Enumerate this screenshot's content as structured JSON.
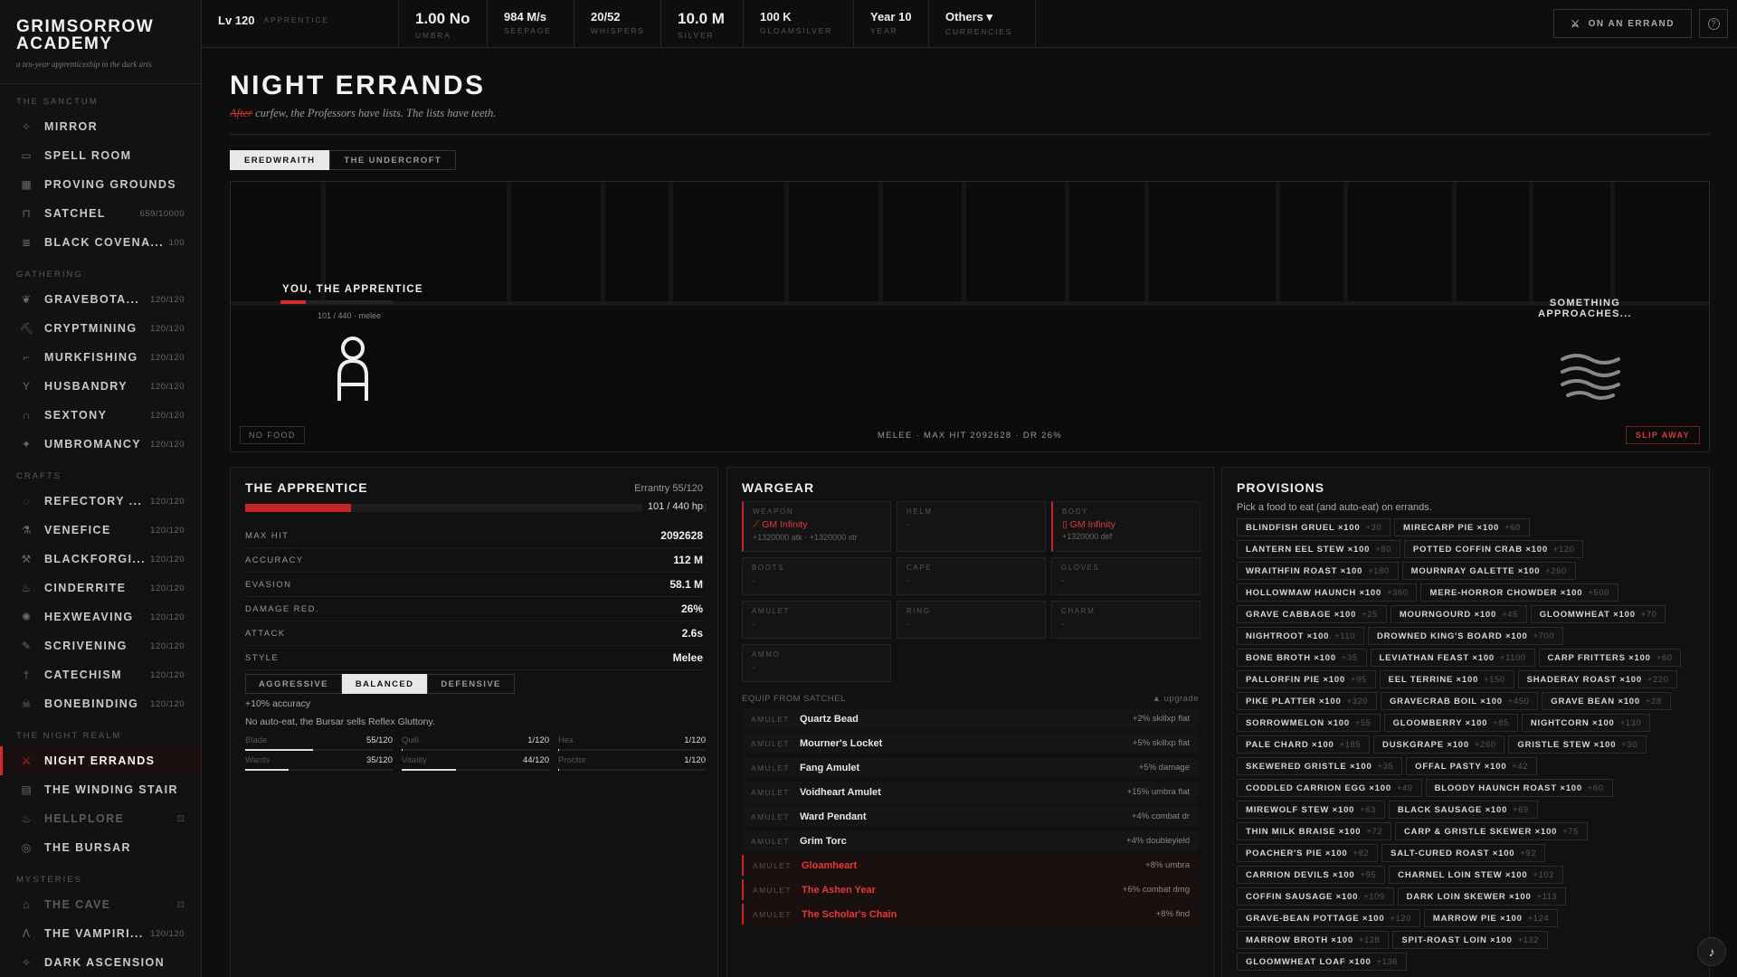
{
  "brand": {
    "title": "GRIMSORROW\nACADEMY",
    "subtitle": "a ten-year apprenticeship in the dark arts"
  },
  "sidebar": {
    "sections": [
      {
        "title": "THE SANCTUM",
        "items": [
          {
            "label": "MIRROR",
            "count": "",
            "icon": "sparkle-icon"
          },
          {
            "label": "SPELL ROOM",
            "count": "",
            "icon": "chat-icon"
          },
          {
            "label": "PROVING GROUNDS",
            "count": "",
            "icon": "grid-icon"
          },
          {
            "label": "SATCHEL",
            "count": "659/10000",
            "icon": "bag-icon"
          },
          {
            "label": "BLACK COVENA...",
            "count": "100",
            "icon": "scroll-icon"
          }
        ]
      },
      {
        "title": "GATHERING",
        "items": [
          {
            "label": "GRAVEBOTA...",
            "count": "120/120",
            "icon": "leaf-icon"
          },
          {
            "label": "CRYPTMINING",
            "count": "120/120",
            "icon": "pick-icon"
          },
          {
            "label": "MURKFISHING",
            "count": "120/120",
            "icon": "hook-icon"
          },
          {
            "label": "HUSBANDRY",
            "count": "120/120",
            "icon": "sprout-icon"
          },
          {
            "label": "SEXTONY",
            "count": "120/120",
            "icon": "tomb-icon"
          },
          {
            "label": "UMBROMANCY",
            "count": "120/120",
            "icon": "star-icon"
          }
        ]
      },
      {
        "title": "CRAFTS",
        "items": [
          {
            "label": "REFECTORY ...",
            "count": "120/120",
            "icon": "pot-icon"
          },
          {
            "label": "VENEFICE",
            "count": "120/120",
            "icon": "flask-icon"
          },
          {
            "label": "BLACKFORGI...",
            "count": "120/120",
            "icon": "hammer-icon"
          },
          {
            "label": "CINDERRITE",
            "count": "120/120",
            "icon": "flame-icon"
          },
          {
            "label": "HEXWEAVING",
            "count": "120/120",
            "icon": "web-icon"
          },
          {
            "label": "SCRIVENING",
            "count": "120/120",
            "icon": "quill-icon"
          },
          {
            "label": "CATECHISM",
            "count": "120/120",
            "icon": "candle-icon"
          },
          {
            "label": "BONEBINDING",
            "count": "120/120",
            "icon": "skull-icon"
          }
        ]
      },
      {
        "title": "THE NIGHT REALM",
        "items": [
          {
            "label": "NIGHT ERRANDS",
            "count": "",
            "icon": "crossed-swords-icon",
            "active": true
          },
          {
            "label": "THE WINDING STAIR",
            "count": "",
            "icon": "stairs-icon"
          },
          {
            "label": "HELLPLORE",
            "count": "",
            "icon": "flame-icon",
            "locked": true
          },
          {
            "label": "THE BURSAR",
            "count": "",
            "icon": "coin-icon"
          }
        ]
      },
      {
        "title": "MYSTERIES",
        "items": [
          {
            "label": "THE CAVE",
            "count": "",
            "icon": "cave-icon",
            "locked": true
          },
          {
            "label": "THE VAMPIRI...",
            "count": "120/120",
            "icon": "fang-icon"
          },
          {
            "label": "DARK ASCENSION",
            "count": "",
            "icon": "sparkle-icon"
          }
        ]
      }
    ]
  },
  "topbar": {
    "level": {
      "value": "Lv 120",
      "label": "APPRENTICE"
    },
    "stats": [
      {
        "value": "1.00 No",
        "label": "UMBRA",
        "big": true
      },
      {
        "value": "984 M/s",
        "label": "SEEPAGE"
      },
      {
        "value": "20/52",
        "label": "WHISPERS"
      },
      {
        "value": "10.0 M",
        "label": "SILVER",
        "big": true
      },
      {
        "value": "100 K",
        "label": "GLOAMSILVER"
      },
      {
        "value": "Year 10",
        "label": "YEAR"
      },
      {
        "value": "Others ▾",
        "label": "CURRENCIES"
      }
    ],
    "errand_button": "ON AN ERRAND",
    "help_icon": "?"
  },
  "page": {
    "title": "NIGHT ERRANDS",
    "sub_struck": "After",
    "sub_rest": " curfew, the Professors have lists. The lists have teeth."
  },
  "locations": [
    "EREDWRAITH",
    "THE UNDERCROFT"
  ],
  "arena": {
    "player_name": "YOU, THE APPRENTICE",
    "player_hp": "101 / 440 · melee",
    "player_hp_fraction": 0.2295,
    "foe_name": "SOMETHING APPROACHES...",
    "no_food": "NO FOOD",
    "combat_line": "MELEE · MAX HIT 2092628 · DR 26%",
    "slip": "SLIP AWAY"
  },
  "apprentice": {
    "title": "THE APPRENTICE",
    "errantry": "Errantry 55/120",
    "hp_text": "101 / 440 hp",
    "hp_fraction": 0.2295,
    "stats": [
      {
        "k": "MAX HIT",
        "v": "2092628"
      },
      {
        "k": "ACCURACY",
        "v": "112 M"
      },
      {
        "k": "EVASION",
        "v": "58.1 M"
      },
      {
        "k": "DAMAGE RED.",
        "v": "26%"
      },
      {
        "k": "ATTACK",
        "v": "2.6s"
      },
      {
        "k": "STYLE",
        "v": "Melee"
      }
    ],
    "styles": [
      "AGGRESSIVE",
      "BALANCED",
      "DEFENSIVE"
    ],
    "active_style": 1,
    "accuracy_note": "+10% accuracy",
    "bursar_note": "No auto-eat, the Bursar sells Reflex Gluttony.",
    "skills": [
      {
        "name": "Blade",
        "level": "55/120",
        "fraction": 0.458
      },
      {
        "name": "Quill",
        "level": "1/120",
        "fraction": 0.008
      },
      {
        "name": "Hex",
        "level": "1/120",
        "fraction": 0.008
      },
      {
        "name": "Wards",
        "level": "35/120",
        "fraction": 0.292
      },
      {
        "name": "Vitality",
        "level": "44/120",
        "fraction": 0.367
      },
      {
        "name": "Proctor",
        "level": "1/120",
        "fraction": 0.008
      }
    ]
  },
  "wargear": {
    "title": "WARGEAR",
    "slots": [
      {
        "slot": "WEAPON",
        "item": "⟋ GM Infinity",
        "bonus": "+1320000 atk · +1320000 str",
        "filled": true
      },
      {
        "slot": "HELM",
        "item": "-",
        "bonus": ""
      },
      {
        "slot": "BODY",
        "item": "▯ GM Infinity",
        "bonus": "+1320000 def",
        "filled": true
      },
      {
        "slot": "BOOTS",
        "item": "-",
        "bonus": ""
      },
      {
        "slot": "CAPE",
        "item": "-",
        "bonus": ""
      },
      {
        "slot": "GLOVES",
        "item": "-",
        "bonus": ""
      },
      {
        "slot": "AMULET",
        "item": "-",
        "bonus": ""
      },
      {
        "slot": "RING",
        "item": "-",
        "bonus": ""
      },
      {
        "slot": "CHARM",
        "item": "-",
        "bonus": ""
      },
      {
        "slot": "AMMO",
        "item": "-",
        "bonus": ""
      }
    ],
    "equip_header": "EQUIP FROM SATCHEL",
    "upgrade_label": "▲ upgrade",
    "equip_items": [
      {
        "type": "AMULET",
        "name": "Quartz Bead",
        "effect": "+2% skillxp flat"
      },
      {
        "type": "AMULET",
        "name": "Mourner's Locket",
        "effect": "+5% skillxp flat"
      },
      {
        "type": "AMULET",
        "name": "Fang Amulet",
        "effect": "+5% damage"
      },
      {
        "type": "AMULET",
        "name": "Voidheart Amulet",
        "effect": "+15% umbra flat"
      },
      {
        "type": "AMULET",
        "name": "Ward Pendant",
        "effect": "+4% combat dr"
      },
      {
        "type": "AMULET",
        "name": "Grim Torc",
        "effect": "+4% doubleyield"
      },
      {
        "type": "AMULET",
        "name": "Gloamheart",
        "effect": "+8% umbra",
        "red": true
      },
      {
        "type": "AMULET",
        "name": "The Ashen Year",
        "effect": "+6% combat dmg",
        "red": true
      },
      {
        "type": "AMULET",
        "name": "The Scholar's Chain",
        "effect": "+8% find",
        "red": true
      }
    ]
  },
  "provisions": {
    "title": "PROVISIONS",
    "note": "Pick a food to eat (and auto-eat) on errands.",
    "foods": [
      {
        "name": "BLINDFISH GRUEL ×100",
        "xp": "+30"
      },
      {
        "name": "MIRECARP PIE ×100",
        "xp": "+60"
      },
      {
        "name": "LANTERN EEL STEW ×100",
        "xp": "+80"
      },
      {
        "name": "POTTED COFFIN CRAB ×100",
        "xp": "+120"
      },
      {
        "name": "WRAITHFIN ROAST ×100",
        "xp": "+180"
      },
      {
        "name": "MOURNRAY GALETTE ×100",
        "xp": "+260"
      },
      {
        "name": "HOLLOWMAW HAUNCH ×100",
        "xp": "+360"
      },
      {
        "name": "MERE-HORROR CHOWDER ×100",
        "xp": "+500"
      },
      {
        "name": "GRAVE CABBAGE ×100",
        "xp": "+25"
      },
      {
        "name": "MOURNGOURD ×100",
        "xp": "+45"
      },
      {
        "name": "GLOOMWHEAT ×100",
        "xp": "+70"
      },
      {
        "name": "NIGHTROOT ×100",
        "xp": "+110"
      },
      {
        "name": "DROWNED KING'S BOARD ×100",
        "xp": "+700"
      },
      {
        "name": "BONE BROTH ×100",
        "xp": "+35"
      },
      {
        "name": "LEVIATHAN FEAST ×100",
        "xp": "+1100"
      },
      {
        "name": "CARP FRITTERS ×100",
        "xp": "+60"
      },
      {
        "name": "PALLORFIN PIE ×100",
        "xp": "+95"
      },
      {
        "name": "EEL TERRINE ×100",
        "xp": "+150"
      },
      {
        "name": "SHADERAY ROAST ×100",
        "xp": "+220"
      },
      {
        "name": "PIKE PLATTER ×100",
        "xp": "+320"
      },
      {
        "name": "GRAVECRAB BOIL ×100",
        "xp": "+450"
      },
      {
        "name": "GRAVE BEAN ×100",
        "xp": "+28"
      },
      {
        "name": "SORROWMELON ×100",
        "xp": "+55"
      },
      {
        "name": "GLOOMBERRY ×100",
        "xp": "+85"
      },
      {
        "name": "NIGHTCORN ×100",
        "xp": "+130"
      },
      {
        "name": "PALE CHARD ×100",
        "xp": "+185"
      },
      {
        "name": "DUSKGRAPE ×100",
        "xp": "+260"
      },
      {
        "name": "GRISTLE STEW ×100",
        "xp": "+30"
      },
      {
        "name": "SKEWERED GRISTLE ×100",
        "xp": "+35"
      },
      {
        "name": "OFFAL PASTY ×100",
        "xp": "+42"
      },
      {
        "name": "CODDLED CARRION EGG ×100",
        "xp": "+49"
      },
      {
        "name": "BLOODY HAUNCH ROAST ×100",
        "xp": "+60"
      },
      {
        "name": "MIREWOLF STEW ×100",
        "xp": "+63"
      },
      {
        "name": "BLACK SAUSAGE ×100",
        "xp": "+69"
      },
      {
        "name": "THIN MILK BRAISE ×100",
        "xp": "+72"
      },
      {
        "name": "CARP & GRISTLE SKEWER ×100",
        "xp": "+75"
      },
      {
        "name": "POACHER'S PIE ×100",
        "xp": "+82"
      },
      {
        "name": "SALT-CURED ROAST ×100",
        "xp": "+92"
      },
      {
        "name": "CARRION DEVILS ×100",
        "xp": "+95"
      },
      {
        "name": "CHARNEL LOIN STEW ×100",
        "xp": "+102"
      },
      {
        "name": "COFFIN SAUSAGE ×100",
        "xp": "+109"
      },
      {
        "name": "DARK LOIN SKEWER ×100",
        "xp": "+113"
      },
      {
        "name": "GRAVE-BEAN POTTAGE ×100",
        "xp": "+120"
      },
      {
        "name": "MARROW PIE ×100",
        "xp": "+124"
      },
      {
        "name": "MARROW BROTH ×100",
        "xp": "+128"
      },
      {
        "name": "SPIT-ROAST LOIN ×100",
        "xp": "+132"
      },
      {
        "name": "GLOOMWHEAT LOAF ×100",
        "xp": "+136"
      }
    ]
  },
  "music_icon": "♪"
}
